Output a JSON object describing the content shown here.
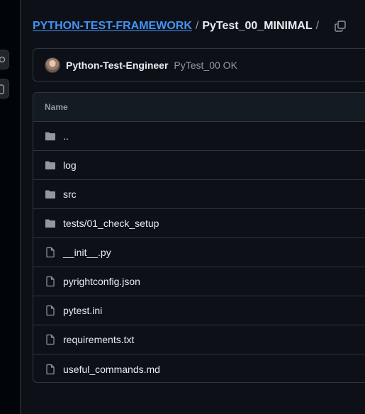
{
  "breadcrumb": {
    "repo": "PYTHON-TEST-FRAMEWORK",
    "separator": "/",
    "current": "PyTest_00_MINIMAL",
    "trailing": "/"
  },
  "commit": {
    "author": "Python-Test-Engineer",
    "message": "PyTest_00 OK"
  },
  "table": {
    "header": "Name",
    "rows": [
      {
        "name": "..",
        "icon": "folder-icon"
      },
      {
        "name": "log",
        "icon": "folder-icon"
      },
      {
        "name": "src",
        "icon": "folder-icon"
      },
      {
        "name": "tests/01_check_setup",
        "icon": "folder-icon"
      },
      {
        "name": "__init__.py",
        "icon": "file-icon"
      },
      {
        "name": "pyrightconfig.json",
        "icon": "file-icon"
      },
      {
        "name": "pytest.ini",
        "icon": "file-icon"
      },
      {
        "name": "requirements.txt",
        "icon": "file-icon"
      },
      {
        "name": "useful_commands.md",
        "icon": "file-icon"
      }
    ]
  },
  "colors": {
    "background": "#0d1117",
    "link": "#4493f8",
    "border": "#30363d",
    "muted": "#9198a1"
  }
}
